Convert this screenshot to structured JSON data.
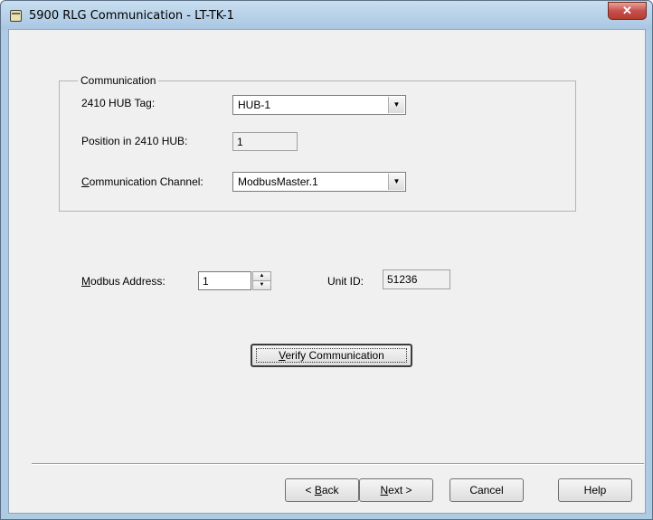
{
  "window": {
    "title": "5900 RLG Communication - LT-TK-1",
    "close_glyph": "✕",
    "app_icon": "tank-gauge-icon"
  },
  "communication_group": {
    "legend": "Communication",
    "hub_tag_label": "2410 HUB Tag:",
    "hub_tag_value": "HUB-1",
    "position_label": "Position in 2410 HUB:",
    "position_value": "1",
    "channel_label_first": "C",
    "channel_label_rest": "ommunication Channel:",
    "channel_value": "ModbusMaster.1"
  },
  "modbus": {
    "address_label_first": "M",
    "address_label_rest": "odbus Address:",
    "address_value": "1",
    "unit_id_label": "Unit ID:",
    "unit_id_value": "51236"
  },
  "verify": {
    "label_first": "V",
    "label_rest": "erify Communication"
  },
  "footer": {
    "back_pre": "< ",
    "back_key": "B",
    "back_rest": "ack",
    "next_key": "N",
    "next_rest": "ext >",
    "cancel": "Cancel",
    "help": "Help"
  },
  "icons": {
    "dropdown": "▼",
    "spin_up": "▲",
    "spin_down": "▼"
  }
}
